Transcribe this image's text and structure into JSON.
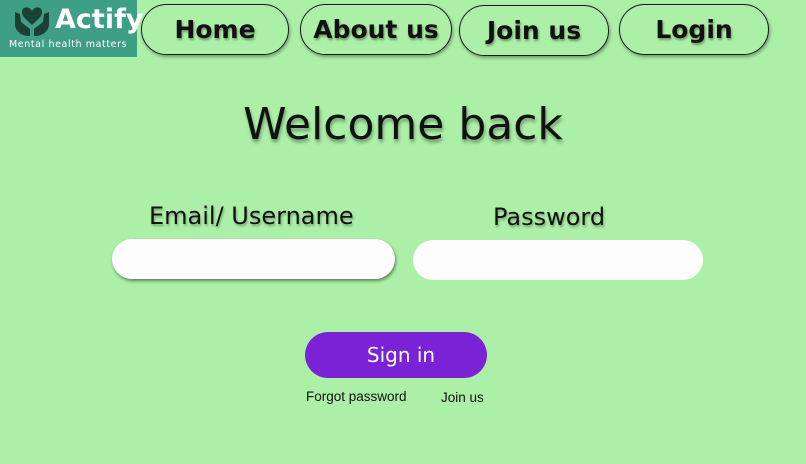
{
  "brand": {
    "name": "Actify",
    "tagline": "Mental health matters",
    "color": "#3f9e86",
    "icon": "hands-heart-icon"
  },
  "nav": {
    "items": [
      {
        "label": "Home"
      },
      {
        "label": "About us"
      },
      {
        "label": "Join us"
      },
      {
        "label": "Login"
      }
    ]
  },
  "main": {
    "title": "Welcome back",
    "email_label": "Email/ Username",
    "email_value": "",
    "password_label": "Password",
    "password_value": "",
    "signin_label": "Sign in",
    "forgot_label": "Forgot password",
    "join_label": "Join us"
  },
  "colors": {
    "background": "#acefa7",
    "signin_button": "#7c22d6"
  }
}
